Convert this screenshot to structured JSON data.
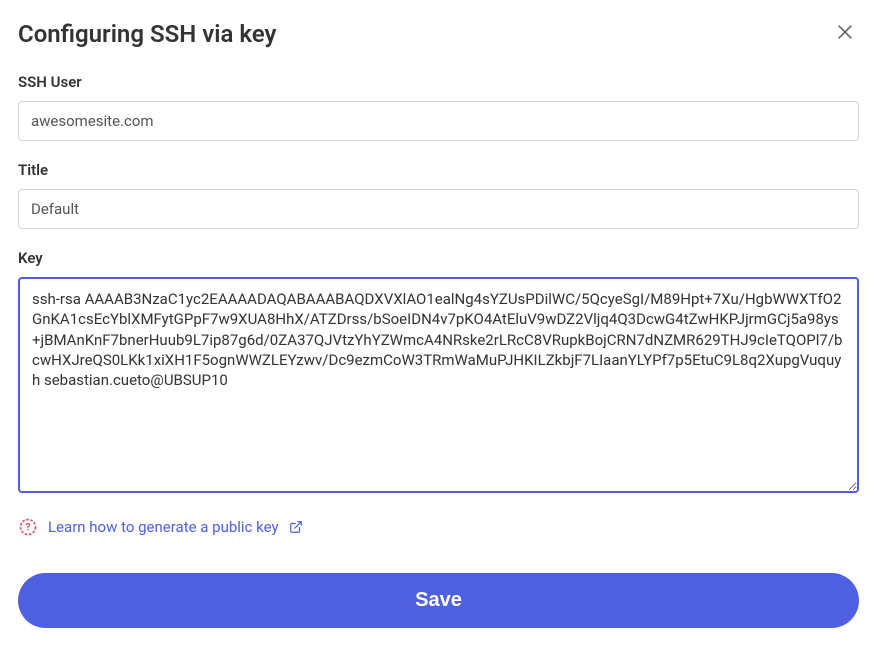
{
  "dialog": {
    "title": "Configuring SSH via key"
  },
  "form": {
    "sshUser": {
      "label": "SSH User",
      "value": "awesomesite.com"
    },
    "title": {
      "label": "Title",
      "value": "Default"
    },
    "key": {
      "label": "Key",
      "value": "ssh-rsa AAAAB3NzaC1yc2EAAAADAQABAAABAQDXVXlAO1ealNg4sYZUsPDilWC/5QcyeSgI/M89Hpt+7Xu/HgbWWXTfO2GnKA1csEcYblXMFytGPpF7w9XUA8HhX/ATZDrss/bSoeIDN4v7pKO4AtEluV9wDZ2Vljq4Q3DcwG4tZwHKPJjrmGCj5a98ys+jBMAnKnF7bnerHuub9L7ip87g6d/0ZA37QJVtzYhYZWmcA4NRske2rLRcC8VRupkBojCRN7dNZMR629THJ9cIeTQOPl7/bcwHXJreQS0LKk1xiXH1F5ognWWZLEYzwv/Dc9ezmCoW3TRmWaMuPJHKILZkbjF7LIaanYLYPf7p5EtuC9L8q2XupgVuquyh sebastian.cueto@UBSUP10"
    }
  },
  "help": {
    "linkText": "Learn how to generate a public key"
  },
  "actions": {
    "save": "Save"
  }
}
